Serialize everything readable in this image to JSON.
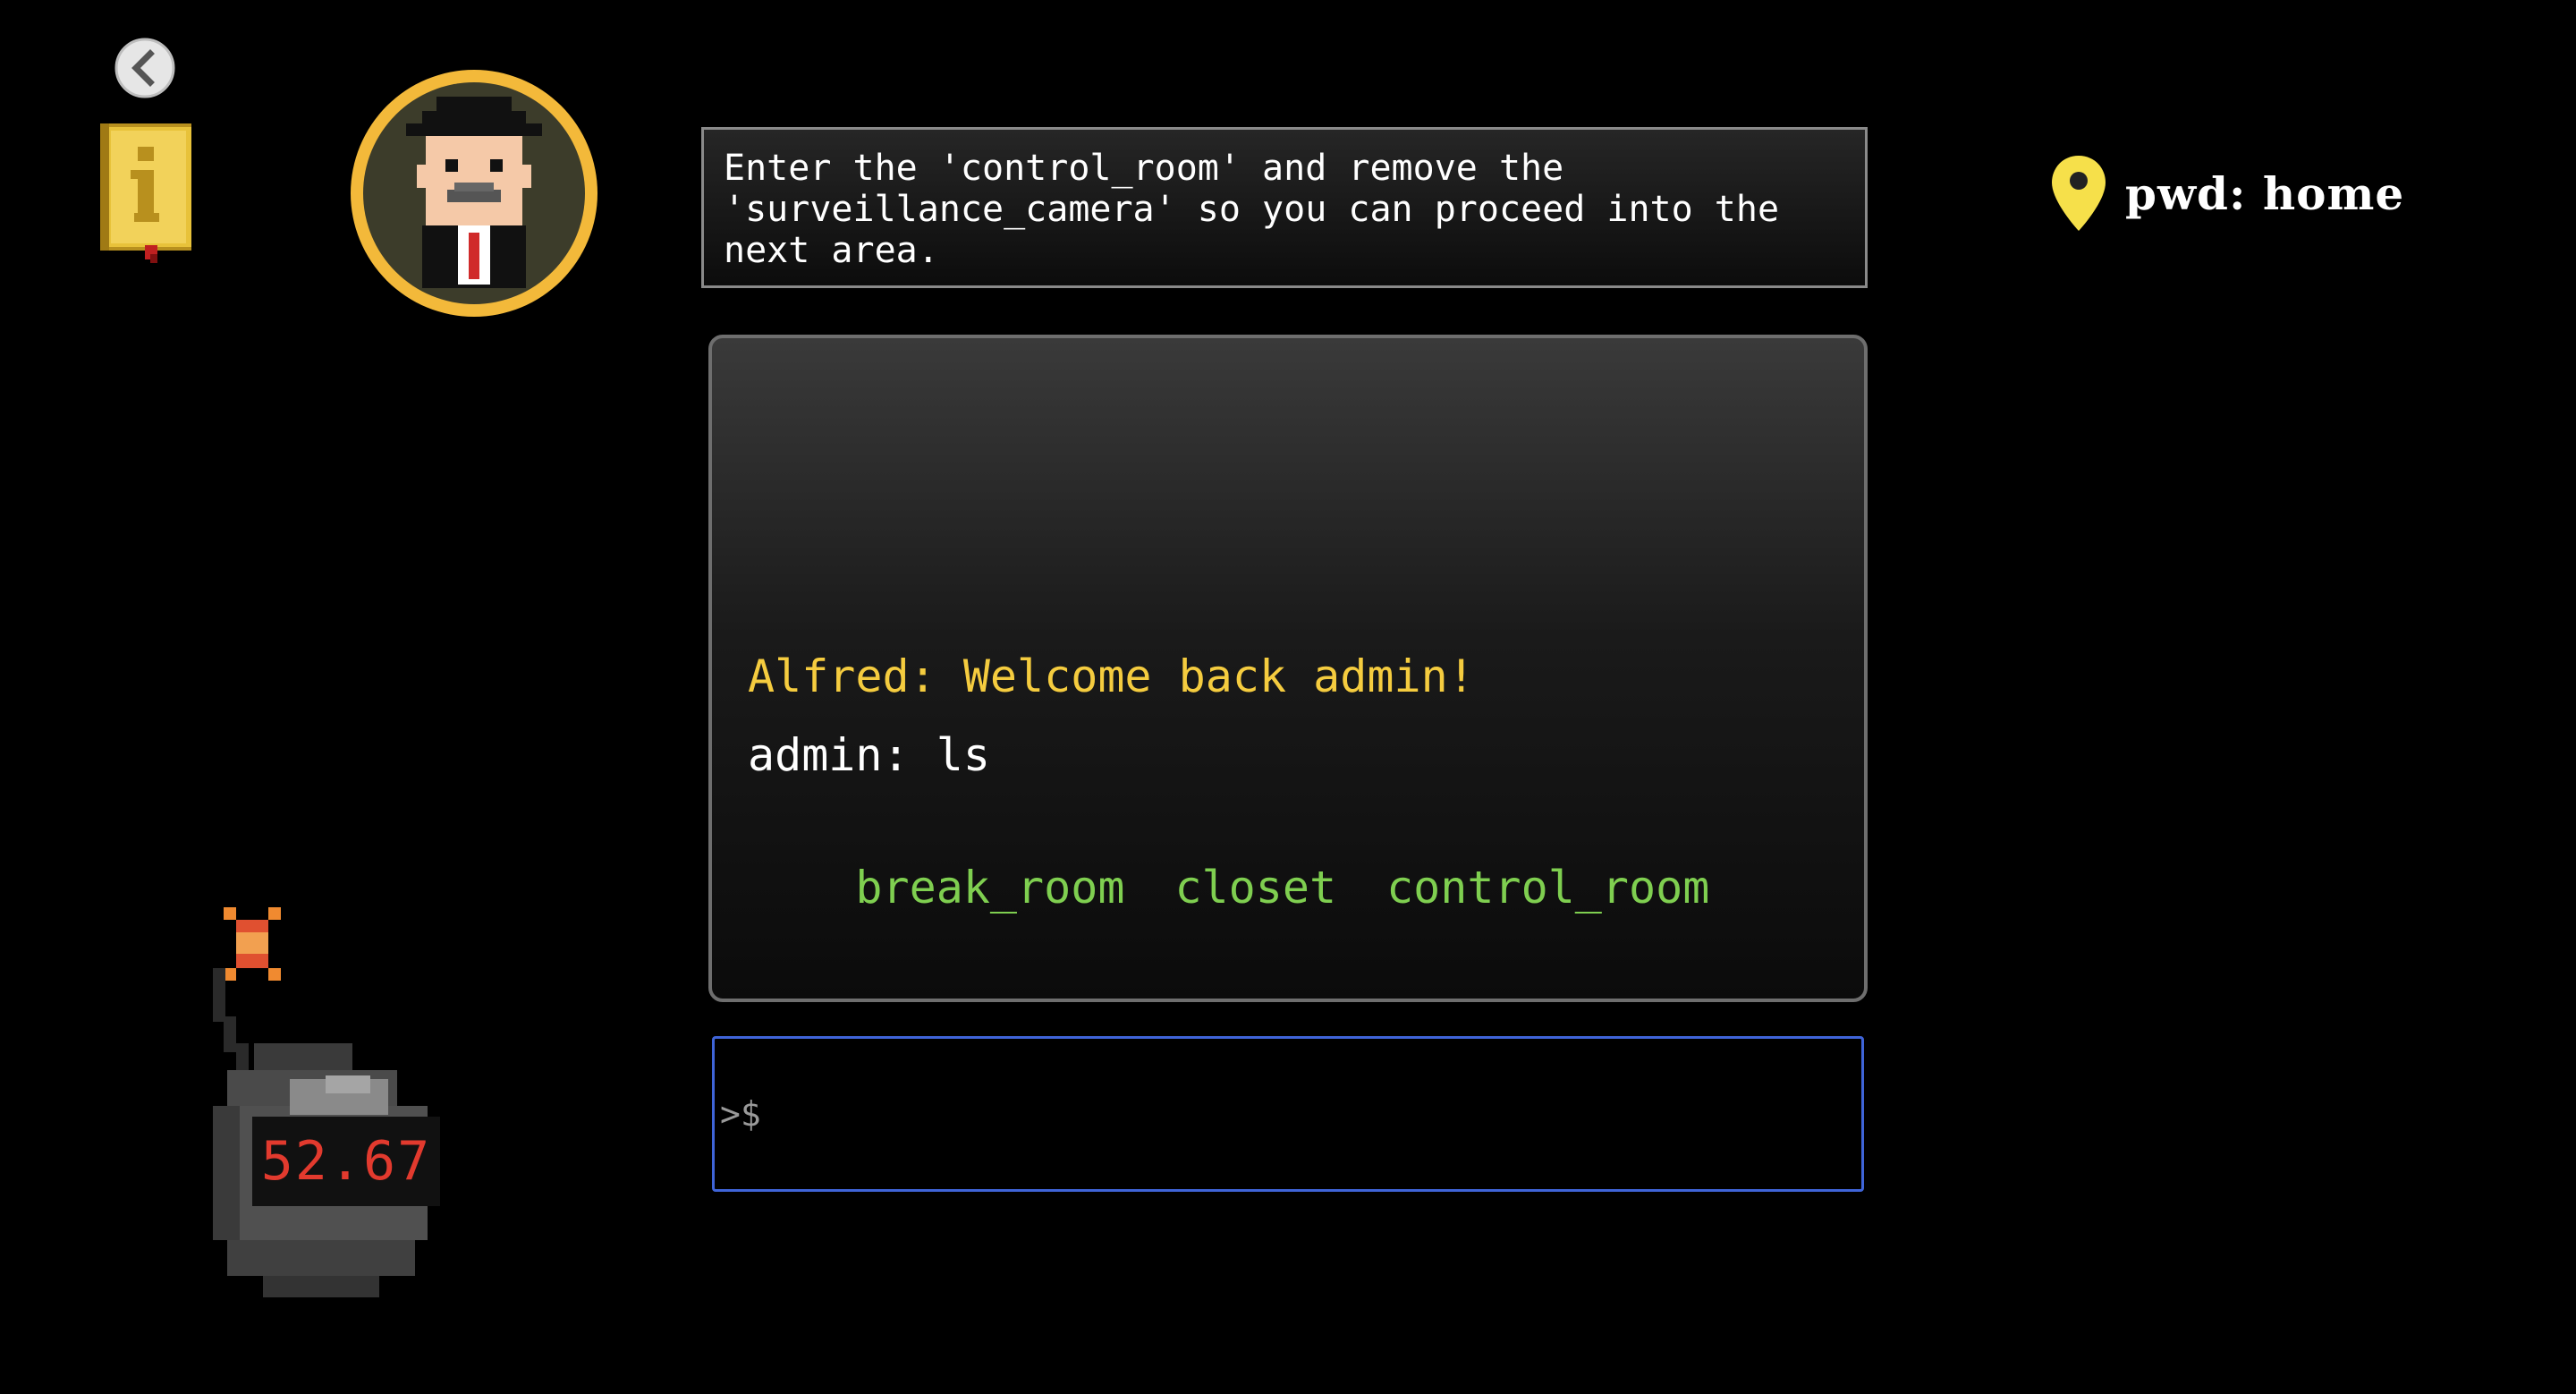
{
  "header": {
    "back_icon": "back-arrow-icon",
    "info_icon": "info-book-icon",
    "avatar_icon": "alfred-butler-avatar"
  },
  "mission": {
    "text": "Enter the 'control_room' and remove the\n'surveillance_camera' so you can proceed into the\nnext area."
  },
  "location": {
    "icon": "map-pin-icon",
    "text": "pwd: home"
  },
  "terminal": {
    "lines": [
      {
        "type": "alfred",
        "text": "Alfred: Welcome back admin!"
      },
      {
        "type": "user",
        "text": "admin: ls"
      }
    ],
    "listing": [
      "break_room",
      "closet",
      "control_room"
    ]
  },
  "command": {
    "prompt": ">$",
    "value": ""
  },
  "bomb": {
    "timer": "52.67"
  },
  "colors": {
    "background": "#000000",
    "alfred_text": "#f5cc3f",
    "listing_text": "#7fcf50",
    "input_border": "#3f64d8",
    "timer_text": "#e23a2e",
    "avatar_ring": "#f3b93a",
    "pin": "#f6e04a"
  }
}
